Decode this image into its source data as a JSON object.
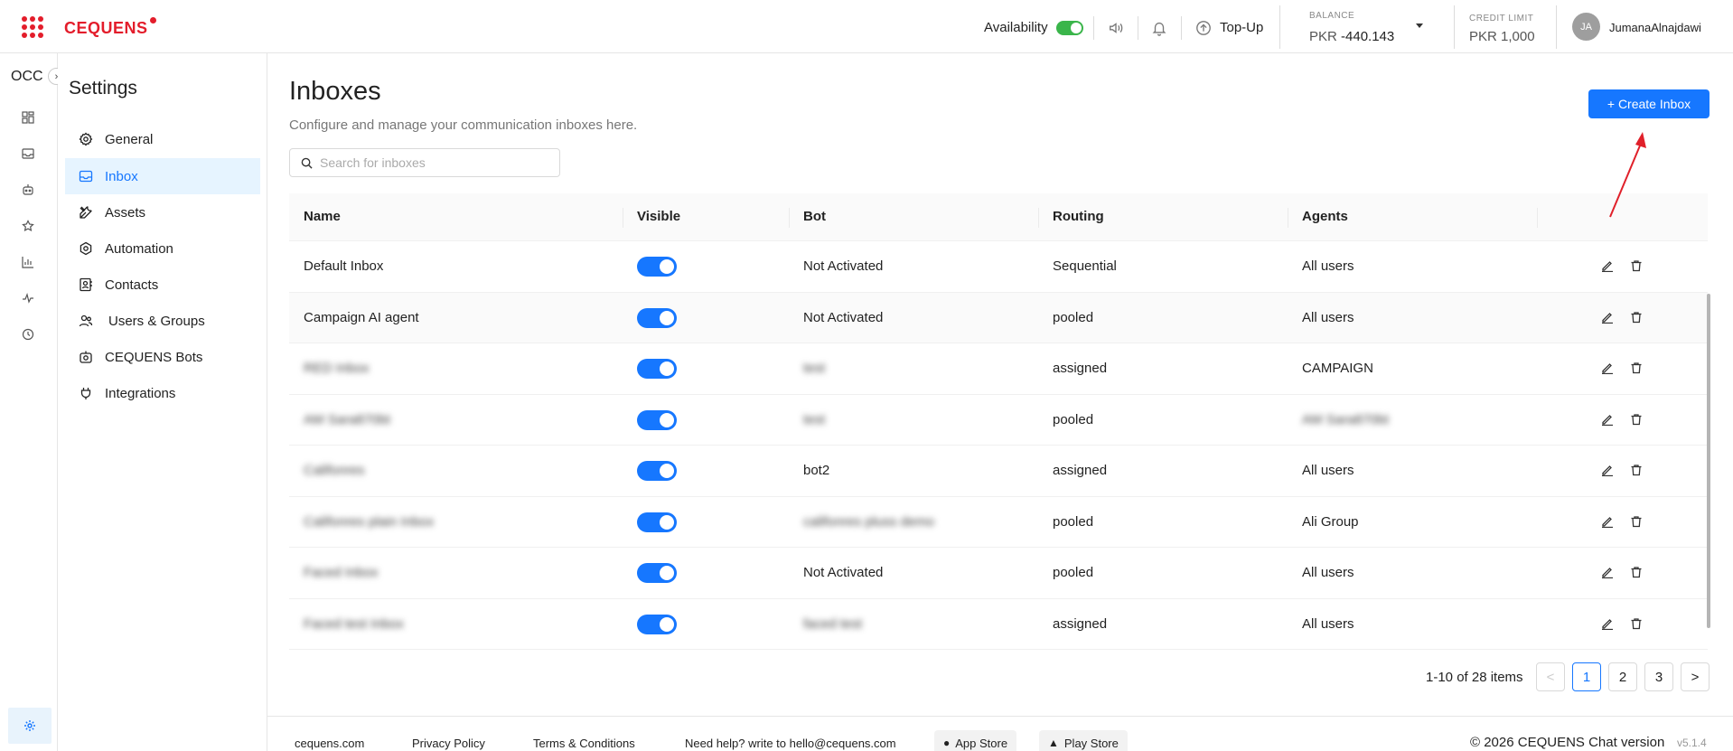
{
  "topbar": {
    "brand": "CEQUENS",
    "availability_label": "Availability",
    "topup_label": "Top-Up",
    "balance_label": "BALANCE",
    "balance_currency": "PKR",
    "balance_value": "-440.143",
    "credit_label": "CREDIT LIMIT",
    "credit_value": "PKR 1,000",
    "avatar_initials": "JA",
    "username": "JumanaAlnajdawi"
  },
  "rail": {
    "title": "OCC"
  },
  "settings": {
    "title": "Settings",
    "items": [
      {
        "label": "General",
        "icon": "gear-icon"
      },
      {
        "label": "Inbox",
        "icon": "inbox-icon"
      },
      {
        "label": "Assets",
        "icon": "tools-icon"
      },
      {
        "label": "Automation",
        "icon": "automation-icon"
      },
      {
        "label": "Contacts",
        "icon": "contacts-icon"
      },
      {
        "label": "Users & Groups",
        "icon": "users-icon"
      },
      {
        "label": "CEQUENS Bots",
        "icon": "bot-icon"
      },
      {
        "label": "Integrations",
        "icon": "plug-icon"
      }
    ]
  },
  "main": {
    "title": "Inboxes",
    "subtitle": "Configure and manage your communication inboxes here.",
    "search_placeholder": "Search for inboxes",
    "create_label": "+ Create Inbox"
  },
  "table": {
    "headers": [
      "Name",
      "Visible",
      "Bot",
      "Routing",
      "Agents"
    ],
    "rows": [
      {
        "name": "Default Inbox",
        "bot": "Not Activated",
        "routing": "Sequential",
        "agents": "All users"
      },
      {
        "name": "Campaign AI agent",
        "bot": "Not Activated",
        "routing": "pooled",
        "agents": "All users"
      },
      {
        "name": "RED Inbox",
        "bot": "test",
        "routing": "assigned",
        "agents": "CAMPAIGN"
      },
      {
        "name": "AM Sara870bt",
        "bot": "test",
        "routing": "pooled",
        "agents": "AM Sara870bt"
      },
      {
        "name": "Califonres",
        "bot": "bot2",
        "routing": "assigned",
        "agents": "All users"
      },
      {
        "name": "Califonres plain Inbox",
        "bot": "califonres pluss demo",
        "routing": "pooled",
        "agents": "Ali Group"
      },
      {
        "name": "Faced Inbox",
        "bot": "Not Activated",
        "routing": "pooled",
        "agents": "All users"
      },
      {
        "name": "Faced test Inbox",
        "bot": "faced test",
        "routing": "assigned",
        "agents": "All users"
      }
    ]
  },
  "pagination": {
    "summary": "1-10 of 28 items",
    "prev": "<",
    "pages": [
      "1",
      "2",
      "3"
    ],
    "next": ">"
  },
  "footer": {
    "site": "cequens.com",
    "privacy": "Privacy Policy",
    "terms": "Terms & Conditions",
    "help": "Need help? write to hello@cequens.com",
    "app_store": "App Store",
    "play_store": "Play Store",
    "copyright": "© 2026 CEQUENS Chat version",
    "version": "v5.1.4"
  },
  "colors": {
    "brand": "#e31d2b",
    "primary": "#1677ff",
    "availability_on": "#3ab54a"
  }
}
